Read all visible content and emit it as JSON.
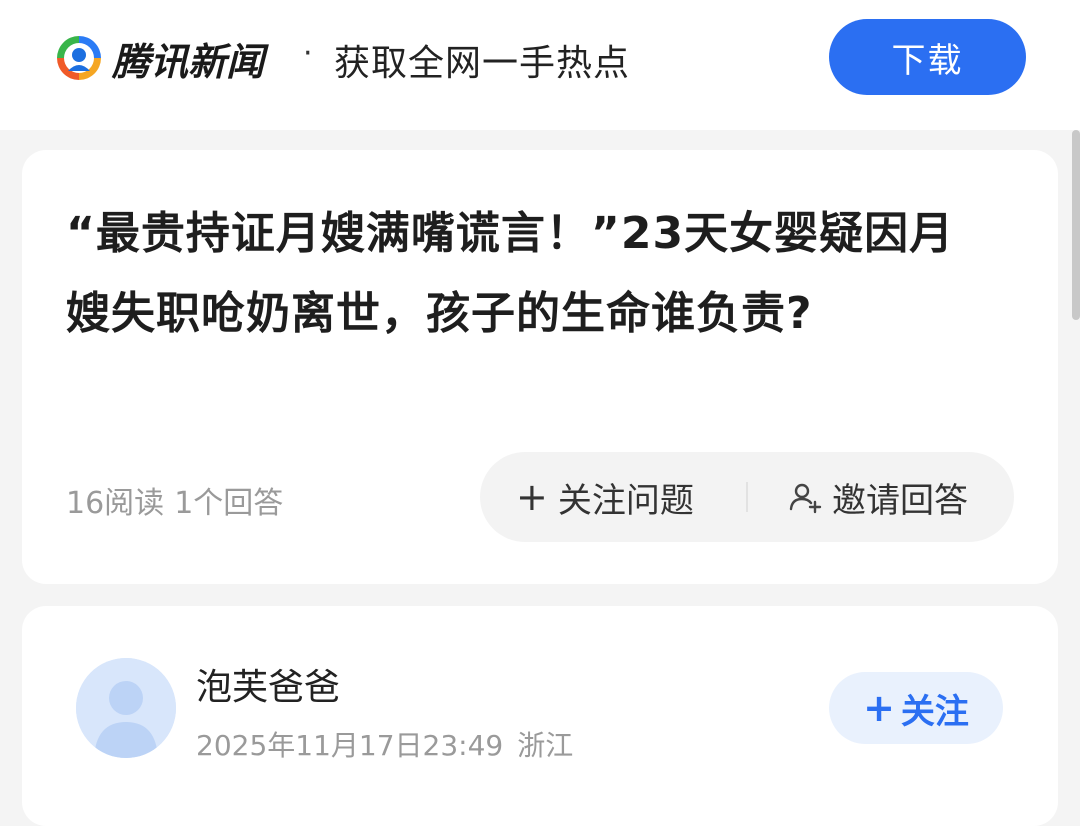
{
  "header": {
    "brand_name": "腾讯新闻",
    "separator": "·",
    "slogan": "获取全网一手热点",
    "download_label": "下载",
    "accent_color": "#2b6ff2"
  },
  "question": {
    "title": "“最贵持证月嫂满嘴谎言！”23天女婴疑因月嫂失职呛奶离世，孩子的生命谁负责?",
    "read_count": "16阅读",
    "answer_count": "1个回答",
    "follow_label": "关注问题",
    "invite_label": "邀请回答"
  },
  "answer": {
    "author_name": "泡芙爸爸",
    "timestamp": "2025年11月17日23:49",
    "location": "浙江",
    "follow_label": "关注"
  },
  "icons": {
    "logo": "tencent-news-logo-icon",
    "plus": "plus-icon",
    "invite": "person-add-icon",
    "avatar": "default-avatar-icon"
  }
}
